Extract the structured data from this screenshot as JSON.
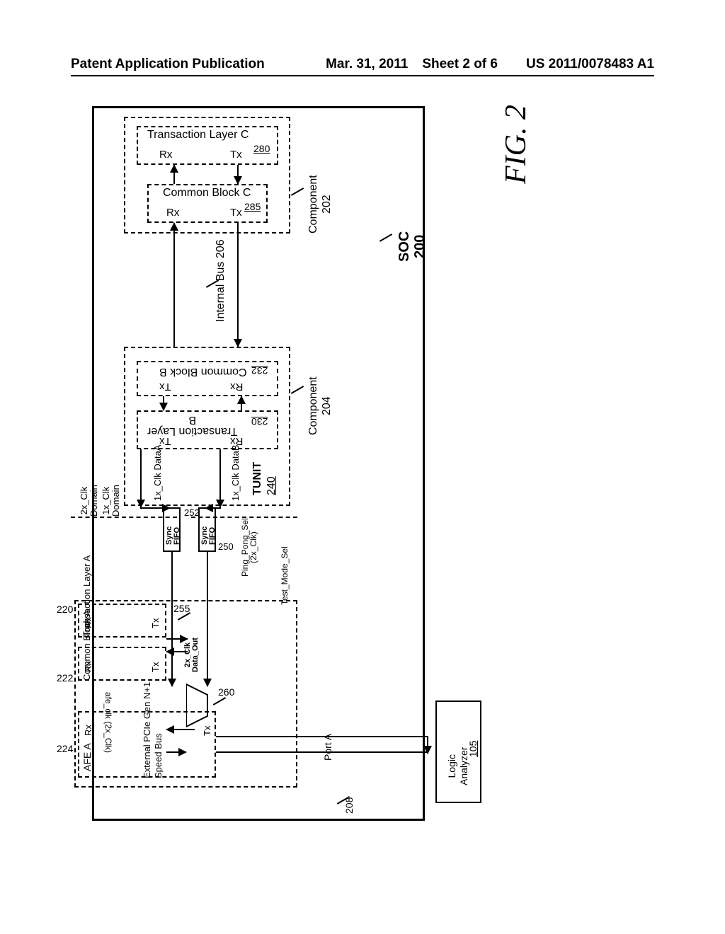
{
  "page": {
    "pub_label": "Patent Application Publication",
    "date": "Mar. 31, 2011",
    "sheet": "Sheet 2 of 6",
    "patno": "US 2011/0078483 A1"
  },
  "fig": {
    "label": "FIG. 2"
  },
  "soc": {
    "label": "SOC\n200"
  },
  "componentC": {
    "label": "Component\n202",
    "tlayer": "Transaction Layer C",
    "tlayer_num": "280",
    "common": "Common Block C",
    "common_num": "285",
    "rx": "Rx",
    "tx": "Tx"
  },
  "internalBus": {
    "label": "Internal Bus 206"
  },
  "componentB": {
    "label": "Component\n204",
    "tlayer": "Transaction Layer\nB",
    "tlayer_num": "230",
    "common": "Common Block B",
    "common_num": "232",
    "tunit": "TUNIT",
    "tunit_num": "240",
    "dataA": "1x_Clk DataA",
    "dataB": "1x_Clk DataB",
    "rx": "Rx",
    "tx": "Tx"
  },
  "clkdomain": {
    "x2": "2x_Clk\nDomain",
    "x1": "1x_Clk\nDomain"
  },
  "componentA": {
    "tlayer": "Transaction Layer A",
    "tlayer_num": "220",
    "common": "Common Block A",
    "common_num": "222",
    "sync1": "Sync\nFIFO",
    "sync1_num": "252",
    "sync2": "Sync\nFIFO",
    "sync2_num": "250",
    "afe": "AFE A",
    "afe_num": "224",
    "data_out": "2x_Clk\nData_Out",
    "mux_num": "260",
    "pingpong": "Ping_Pong_Sel\n(2x_Clk)",
    "testmode": "Test_Mode_Sel",
    "afeclk": "afe_clk (2x_Clk)",
    "num255": "255",
    "rx": "Rx",
    "tx": "Tx"
  },
  "bus208": {
    "label": "External PCIe Gen N+1\nSpeed Bus",
    "num": "208"
  },
  "portA": {
    "label": "Port A"
  },
  "analyzer": {
    "label": "Logic\nAnalyzer",
    "num": "105"
  }
}
